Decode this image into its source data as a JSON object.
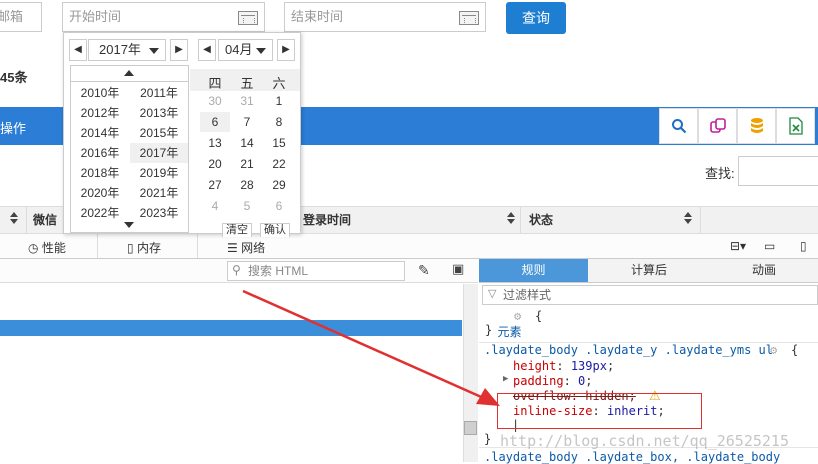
{
  "filters": {
    "email_placeholder": "邮箱",
    "start_placeholder": "开始时间",
    "end_placeholder": "结束时间",
    "query_label": "查询"
  },
  "summary": {
    "total_text": "45条"
  },
  "header": {
    "title": "操作"
  },
  "toolbar": {
    "icons": [
      "search-icon",
      "copy-icon",
      "database-icon",
      "excel-icon"
    ]
  },
  "find": {
    "label": "查找:"
  },
  "table": {
    "columns": [
      "微信",
      "登录时间",
      "状态"
    ]
  },
  "datepicker": {
    "year": "2017年",
    "month": "04月",
    "prev": "◀",
    "next": "▶",
    "years": [
      "2010年",
      "2011年",
      "2012年",
      "2013年",
      "2014年",
      "2015年",
      "2016年",
      "2017年",
      "2018年",
      "2019年",
      "2020年",
      "2021年",
      "2022年",
      "2023年"
    ],
    "current_year": "2017年",
    "weekdays": [
      "四",
      "五",
      "六"
    ],
    "days": [
      [
        "30",
        "31",
        "1"
      ],
      [
        "6",
        "7",
        "8"
      ],
      [
        "13",
        "14",
        "15"
      ],
      [
        "20",
        "21",
        "22"
      ],
      [
        "27",
        "28",
        "29"
      ],
      [
        "4",
        "5",
        "6"
      ]
    ],
    "selected_day": "6",
    "btn_clear": "清空",
    "btn_ok": "确认"
  },
  "devtools": {
    "tabs": [
      "性能",
      "内存",
      "网络"
    ],
    "search_placeholder": "搜索 HTML",
    "right_tabs": [
      "规则",
      "计算后",
      "动画"
    ],
    "filter_placeholder": "过滤样式",
    "element_rule": "元素",
    "brace_open": "{",
    "brace_close": "}",
    "selector": ".laydate_body .laydate_y .laydate_yms ul",
    "props": [
      {
        "name": "height",
        "value": "139px"
      },
      {
        "name": "padding",
        "value": "0"
      },
      {
        "name": "overflow",
        "value": "hidden"
      },
      {
        "name": "inline-size",
        "value": "inherit"
      }
    ],
    "next_selector": ".laydate_body .laydate_box, .laydate_body"
  },
  "watermark": "http://blog.csdn.net/qq_26525215",
  "colors": {
    "primary": "#2b7dd6",
    "query": "#1e7fd2",
    "annotation": "#e03030"
  }
}
